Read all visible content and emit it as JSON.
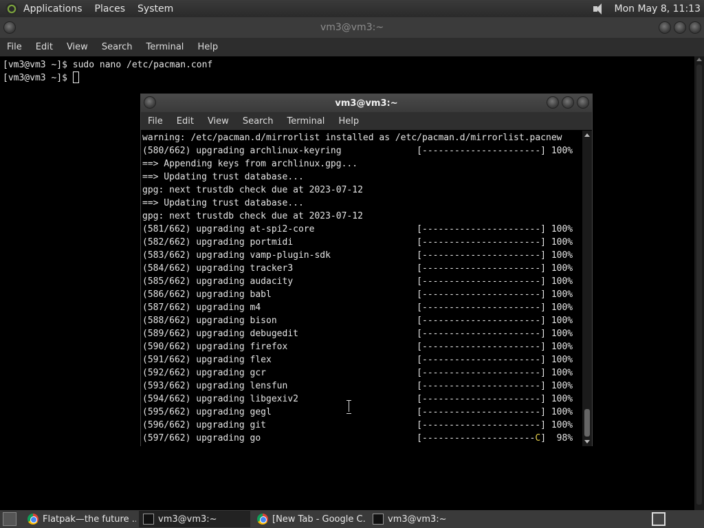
{
  "top_panel": {
    "menus": [
      "Applications",
      "Places",
      "System"
    ],
    "clock": "Mon May  8, 11:13"
  },
  "back_window": {
    "title": "vm3@vm3:~",
    "menu": [
      "File",
      "Edit",
      "View",
      "Search",
      "Terminal",
      "Help"
    ],
    "lines": [
      "[vm3@vm3 ~]$ sudo nano /etc/pacman.conf",
      "[vm3@vm3 ~]$ "
    ]
  },
  "front_window": {
    "title": "vm3@vm3:~",
    "menu": [
      "File",
      "Edit",
      "View",
      "Search",
      "Terminal",
      "Help"
    ],
    "lines": [
      "warning: /etc/pacman.d/mirrorlist installed as /etc/pacman.d/mirrorlist.pacnew",
      "(580/662) upgrading archlinux-keyring              [----------------------] 100%",
      "==> Appending keys from archlinux.gpg...",
      "==> Updating trust database...",
      "gpg: next trustdb check due at 2023-07-12",
      "==> Updating trust database...",
      "gpg: next trustdb check due at 2023-07-12",
      "(581/662) upgrading at-spi2-core                   [----------------------] 100%",
      "(582/662) upgrading portmidi                       [----------------------] 100%",
      "(583/662) upgrading vamp-plugin-sdk                [----------------------] 100%",
      "(584/662) upgrading tracker3                       [----------------------] 100%",
      "(585/662) upgrading audacity                       [----------------------] 100%",
      "(586/662) upgrading babl                           [----------------------] 100%",
      "(587/662) upgrading m4                             [----------------------] 100%",
      "(588/662) upgrading bison                          [----------------------] 100%",
      "(589/662) upgrading debugedit                      [----------------------] 100%",
      "(590/662) upgrading firefox                        [----------------------] 100%",
      "(591/662) upgrading flex                           [----------------------] 100%",
      "(592/662) upgrading gcr                            [----------------------] 100%",
      "(593/662) upgrading lensfun                        [----------------------] 100%",
      "(594/662) upgrading libgexiv2                      [----------------------] 100%",
      "(595/662) upgrading gegl                           [----------------------] 100%",
      "(596/662) upgrading git                            [----------------------] 100%"
    ],
    "last_line_prefix": "(597/662) upgrading go                             [---------------------",
    "last_line_pacman": "C",
    "last_line_suffix": "]  98%"
  },
  "taskbar": {
    "tasks": [
      {
        "label": "Flatpak—the future ...",
        "icon": "chrome-icon"
      },
      {
        "label": "vm3@vm3:~",
        "icon": "terminal-icon"
      },
      {
        "label": "[New Tab - Google C...",
        "icon": "chrome-icon"
      },
      {
        "label": "vm3@vm3:~",
        "icon": "terminal-icon"
      }
    ]
  }
}
